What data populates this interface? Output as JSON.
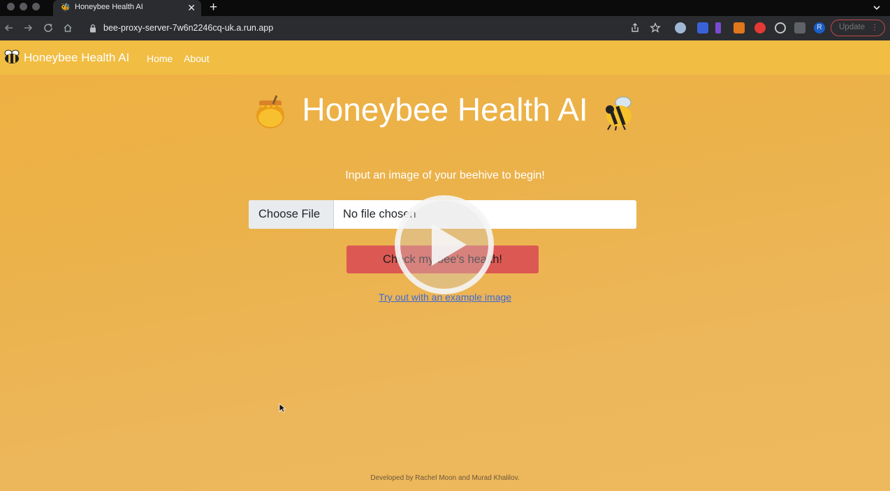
{
  "browser": {
    "tab_title": "Honeybee Health AI",
    "tab_close": "✕",
    "new_tab": "+",
    "url": "bee-proxy-server-7w6n2246cq-uk.a.run.app",
    "update_label": "Update",
    "update_menu": "⋮",
    "profile_initial": "R",
    "accent_color": "#c2484a"
  },
  "navbar": {
    "brand": "Honeybee Health AI",
    "links": [
      "Home",
      "About"
    ],
    "background": "#f1bd43"
  },
  "main": {
    "title": "Honeybee Health AI",
    "subtitle": "Input an image of your beehive to begin!",
    "file_input": {
      "button_label": "Choose File",
      "status": "No file chosen"
    },
    "submit_label": "Check my bee's health!",
    "submit_color": "#dc5852",
    "example_link": "Try out with an example image"
  },
  "footer": {
    "text": "Developed by Rachel Moon and Murad Khalilov."
  },
  "overlay": {
    "icon": "play-icon"
  }
}
